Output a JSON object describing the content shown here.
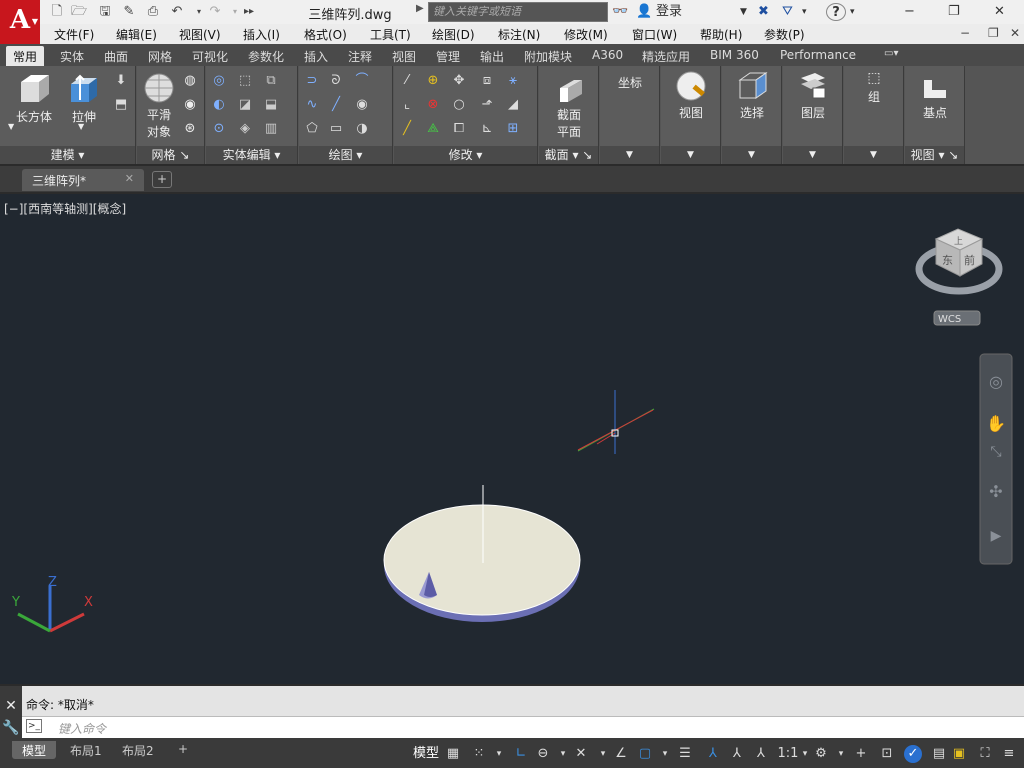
{
  "app": {
    "logo_letter": "A",
    "doc_title": "三维阵列.dwg",
    "search_placeholder": "键入关键字或短语",
    "login_label": "登录"
  },
  "menubar": {
    "items": [
      "文件(F)",
      "编辑(E)",
      "视图(V)",
      "插入(I)",
      "格式(O)",
      "工具(T)",
      "绘图(D)",
      "标注(N)",
      "修改(M)",
      "窗口(W)",
      "帮助(H)",
      "参数(P)"
    ]
  },
  "ribbon_tabs": {
    "items": [
      "常用",
      "实体",
      "曲面",
      "网格",
      "可视化",
      "参数化",
      "插入",
      "注释",
      "视图",
      "管理",
      "输出",
      "附加模块",
      "A360",
      "精选应用",
      "BIM 360",
      "Performance"
    ]
  },
  "ribbon": {
    "box_label": "长方体",
    "extrude_label": "拉伸",
    "smooth_label_1": "平滑",
    "smooth_label_2": "对象",
    "section_label_1": "截面",
    "section_label_2": "平面",
    "coords_label": "坐标",
    "view_label": "视图",
    "select_label": "选择",
    "layer_label": "图层",
    "group_label": "组",
    "basepoint_label": "基点",
    "panels": {
      "modeling": "建模",
      "mesh": "网格",
      "solid_edit": "实体编辑",
      "draw": "绘图",
      "modify": "修改",
      "section": "截面",
      "view": "视图"
    }
  },
  "file_tab": {
    "name": "三维阵列*"
  },
  "viewport": {
    "label": "[−][西南等轴测][概念]",
    "wcs_label": "WCS",
    "viewcube_top": "上",
    "viewcube_left": "东",
    "viewcube_right": "前"
  },
  "ucs": {
    "x": "X",
    "y": "Y",
    "z": "Z"
  },
  "command": {
    "history": "命令: *取消*",
    "placeholder": "键入命令"
  },
  "layout_tabs": {
    "items": [
      "模型",
      "布局1",
      "布局2"
    ]
  },
  "status": {
    "model_label": "模型",
    "scale": "1:1"
  },
  "colors": {
    "autocad_red": "#c8161d",
    "viewport_bg": "#212830",
    "disk_fill": "#e6e4d4",
    "cone_fill": "#9a9ad2",
    "axis_x": "#cf3a3a",
    "axis_y": "#3aa83a",
    "axis_z": "#3a6fd0"
  }
}
